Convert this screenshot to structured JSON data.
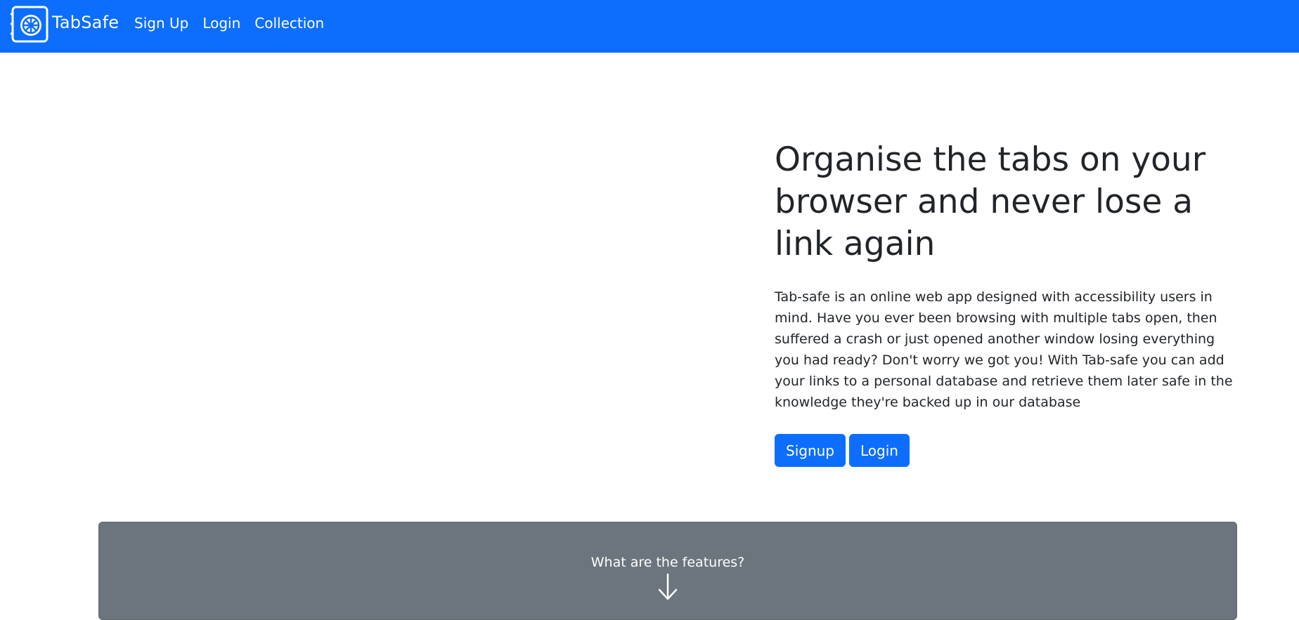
{
  "navbar": {
    "brand": "TabSafe",
    "links": [
      "Sign Up",
      "Login",
      "Collection"
    ],
    "color": "#0d6efd"
  },
  "hero": {
    "title": "Organise the tabs on your browser and never lose a link again",
    "description": "Tab-safe is an online web app designed with accessibility users in mind. Have you ever been browsing with multiple tabs open, then suffered a crash or just opened another window losing everything you had ready? Don't worry we got you! With Tab-safe you can add your links to a personal database and retrieve them later safe in the knowledge they're backed up in our database",
    "buttons": {
      "signup": "Signup",
      "login": "Login"
    }
  },
  "features": {
    "label": "What are the features?",
    "icon": "arrow-down-icon",
    "color": "#6c757d"
  }
}
